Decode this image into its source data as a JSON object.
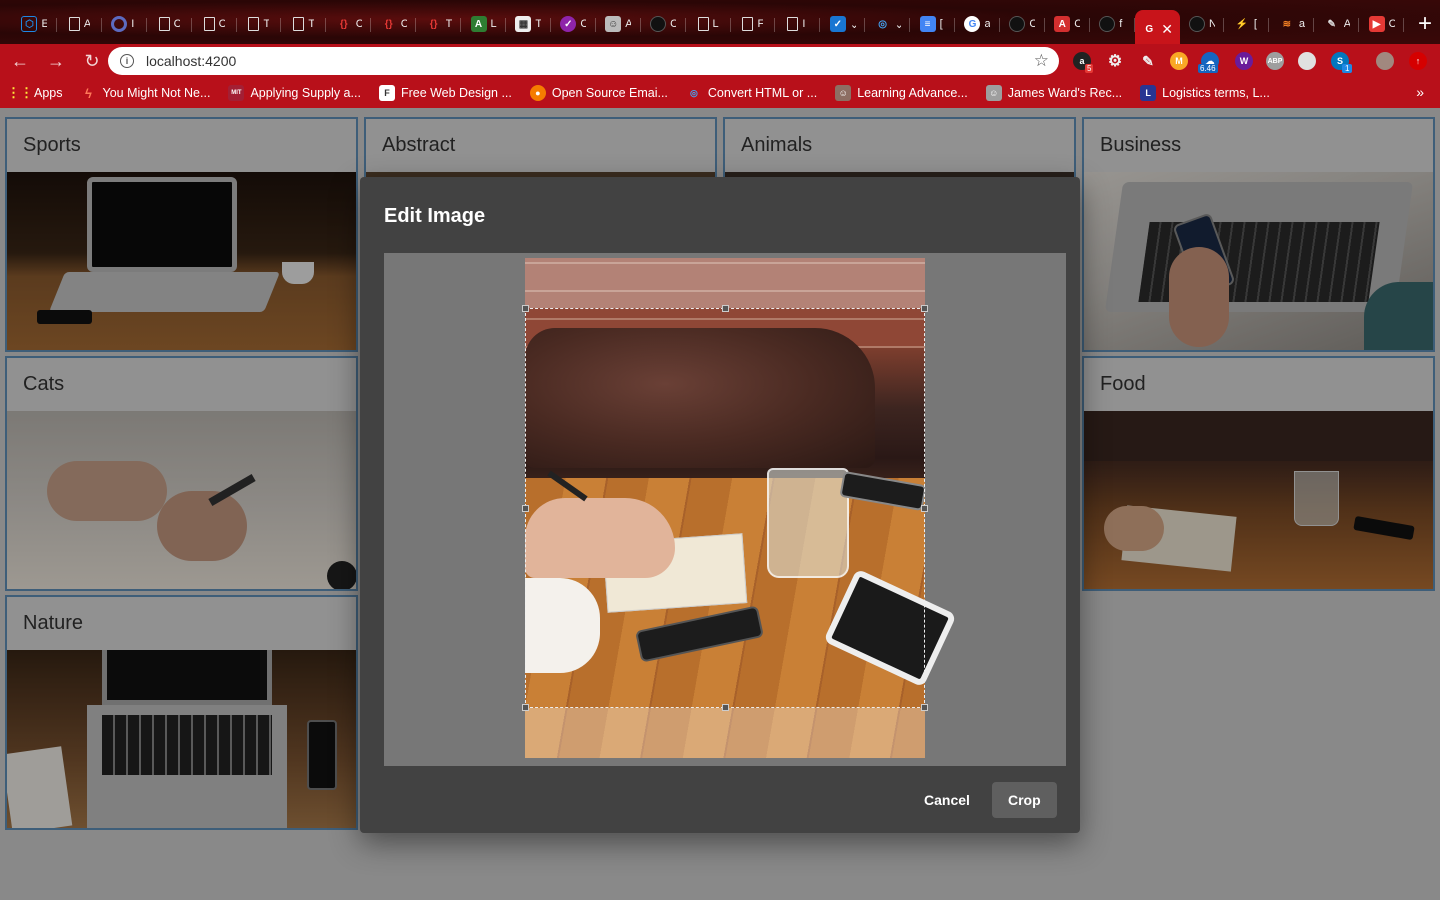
{
  "browser": {
    "url": "localhost:4200",
    "tabs": [
      {
        "letter": "E",
        "icon": "angular-icon",
        "color": "#1e88e5"
      },
      {
        "letter": "A",
        "icon": "page-icon",
        "color": "#555"
      },
      {
        "letter": "I",
        "icon": "ring-icon",
        "color": "#3f51b5"
      },
      {
        "letter": "C",
        "icon": "page-icon",
        "color": "#555"
      },
      {
        "letter": "C",
        "icon": "page-icon",
        "color": "#555"
      },
      {
        "letter": "T",
        "icon": "page-icon",
        "color": "#555"
      },
      {
        "letter": "T",
        "icon": "page-icon",
        "color": "#555"
      },
      {
        "letter": "C",
        "icon": "braces-icon",
        "color": "#c62828"
      },
      {
        "letter": "C",
        "icon": "braces-icon",
        "color": "#c62828"
      },
      {
        "letter": "T",
        "icon": "braces-icon",
        "color": "#c62828"
      },
      {
        "letter": "L",
        "icon": "code-icon",
        "color": "#2e7d32"
      },
      {
        "letter": "T",
        "icon": "puzzle-icon",
        "color": "#666"
      },
      {
        "letter": "C",
        "icon": "check-icon",
        "color": "#7b1fa2"
      },
      {
        "letter": "A",
        "icon": "avatar-icon",
        "color": "#888"
      },
      {
        "letter": "C",
        "icon": "github-icon",
        "color": "#222"
      },
      {
        "letter": "L",
        "icon": "page-icon",
        "color": "#555"
      },
      {
        "letter": "F",
        "icon": "page-icon",
        "color": "#555"
      },
      {
        "letter": "I",
        "icon": "page-icon",
        "color": "#555"
      },
      {
        "letter": "⌄",
        "icon": "todo-icon",
        "color": "#1976d2"
      },
      {
        "letter": "⌄",
        "icon": "globe-icon",
        "color": "#1565c0"
      },
      {
        "letter": "[",
        "icon": "docs-icon",
        "color": "#4285f4"
      },
      {
        "letter": "a",
        "icon": "google-icon",
        "color": "#fff"
      },
      {
        "letter": "C",
        "icon": "github-icon",
        "color": "#222"
      },
      {
        "letter": "C",
        "icon": "angular-red-icon",
        "color": "#d32f2f"
      },
      {
        "letter": "f",
        "icon": "github-icon",
        "color": "#222"
      }
    ],
    "active_tab": {
      "letter": "G",
      "icon": "g-icon"
    },
    "tabs_after": [
      {
        "letter": "N",
        "icon": "github-icon",
        "color": "#222"
      },
      {
        "letter": "[",
        "icon": "bolt-icon",
        "color": "#1e88e5"
      },
      {
        "letter": "a",
        "icon": "stack-icon",
        "color": "#f48024"
      },
      {
        "letter": "A",
        "icon": "pen-icon",
        "color": "#888"
      },
      {
        "letter": "C",
        "icon": "youtube-icon",
        "color": "#e53935"
      }
    ],
    "bookmarks": [
      {
        "label": "Apps",
        "icon": "apps-grid-icon",
        "color": "#e53935"
      },
      {
        "label": "You Might Not Ne...",
        "icon": "hubspot-icon",
        "color": "#ff7a59"
      },
      {
        "label": "Applying Supply a...",
        "icon": "mit-icon",
        "color": "#a31f34"
      },
      {
        "label": "Free Web Design ...",
        "icon": "design-icon",
        "color": "#333"
      },
      {
        "label": "Open Source Emai...",
        "icon": "email-icon",
        "color": "#f57c00"
      },
      {
        "label": "Convert HTML or ...",
        "icon": "convert-icon",
        "color": "#1e88e5"
      },
      {
        "label": "Learning Advance...",
        "icon": "person-icon",
        "color": "#8d6e63"
      },
      {
        "label": "James Ward's Rec...",
        "icon": "person-icon",
        "color": "#757575"
      },
      {
        "label": "Logistics terms, L...",
        "icon": "l-icon",
        "color": "#283593"
      }
    ],
    "extensions": [
      {
        "name": "amazon-icon",
        "badge": "5",
        "color": "#222"
      },
      {
        "name": "gear-icon",
        "badge": "",
        "color": "#444"
      },
      {
        "name": "pen-icon",
        "badge": "",
        "color": "#444"
      },
      {
        "name": "mtext-icon",
        "badge": "",
        "color": "#f9a825"
      },
      {
        "name": "weather-icon",
        "badge": "6.46",
        "color": "#1565c0"
      },
      {
        "name": "wappalyzer-icon",
        "badge": "",
        "color": "#6a1b9a"
      },
      {
        "name": "abp-icon",
        "badge": "",
        "color": "#9e9e9e"
      },
      {
        "name": "circle-icon",
        "badge": "",
        "color": "#e0e0e0"
      },
      {
        "name": "stack-ext-icon",
        "badge": "1",
        "color": "#0277bd"
      },
      {
        "name": "profile-avatar-icon",
        "badge": "",
        "color": "#8d6e63"
      },
      {
        "name": "update-icon",
        "badge": "",
        "color": "#d50000"
      }
    ]
  },
  "cards": [
    {
      "title": "Sports"
    },
    {
      "title": "Abstract"
    },
    {
      "title": "Animals"
    },
    {
      "title": "Business"
    },
    {
      "title": "Cats"
    },
    {
      "title": "Food"
    },
    {
      "title": "Nature"
    }
  ],
  "dialog": {
    "title": "Edit Image",
    "cancel_label": "Cancel",
    "crop_label": "Crop"
  }
}
